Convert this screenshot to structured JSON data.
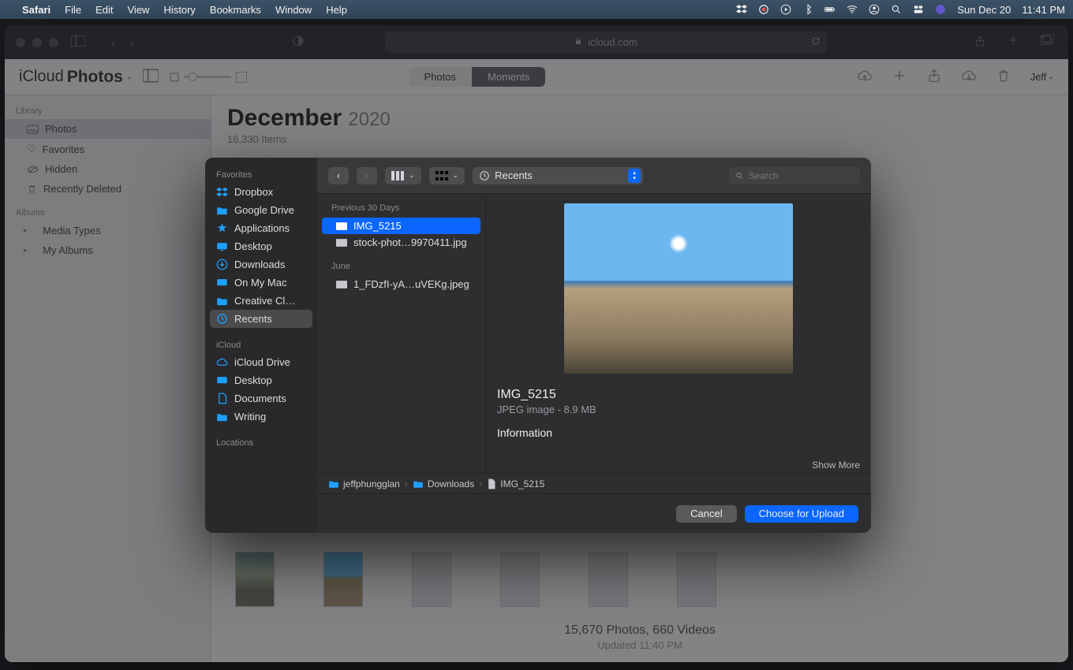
{
  "menubar": {
    "app": "Safari",
    "items": [
      "File",
      "Edit",
      "View",
      "History",
      "Bookmarks",
      "Window",
      "Help"
    ],
    "date": "Sun Dec 20",
    "time": "11:41 PM"
  },
  "safari": {
    "url_host": "icloud.com"
  },
  "photos": {
    "brand_prefix": "iCloud",
    "brand_word": "Photos",
    "segments": {
      "photos": "Photos",
      "moments": "Moments"
    },
    "user": "Jeff",
    "sidebar": {
      "library": "Library",
      "albums": "Albums",
      "items": {
        "photos": "Photos",
        "favorites": "Favorites",
        "hidden": "Hidden",
        "recently_deleted": "Recently Deleted",
        "media_types": "Media Types",
        "my_albums": "My Albums"
      }
    },
    "title_month": "December",
    "title_year": "2020",
    "item_count": "16,330 Items",
    "footer_line1": "15,670 Photos, 660 Videos",
    "footer_line2": "Updated 11:40 PM"
  },
  "panel": {
    "sidebar": {
      "favorites": "Favorites",
      "icloud": "iCloud",
      "locations": "Locations",
      "items": {
        "dropbox": "Dropbox",
        "gdrive": "Google Drive",
        "applications": "Applications",
        "desktop": "Desktop",
        "downloads": "Downloads",
        "onmymac": "On My Mac",
        "creative": "Creative Cl…",
        "recents": "Recents",
        "iclouddrive": "iCloud Drive",
        "desktop2": "Desktop",
        "documents": "Documents",
        "writing": "Writing"
      }
    },
    "location": "Recents",
    "search_placeholder": "Search",
    "list": {
      "g1": "Previous 30 Days",
      "f1": "IMG_5215",
      "f2": "stock-phot…9970411.jpg",
      "g2": "June",
      "f3": "1_FDzfI-yA…uVEKg.jpeg"
    },
    "preview": {
      "title": "IMG_5215",
      "meta": "JPEG image - 8.9 MB",
      "info": "Information",
      "showmore": "Show More"
    },
    "path": {
      "a": "jeffphungglan",
      "b": "Downloads",
      "c": "IMG_5215"
    },
    "buttons": {
      "cancel": "Cancel",
      "choose": "Choose for Upload"
    }
  }
}
